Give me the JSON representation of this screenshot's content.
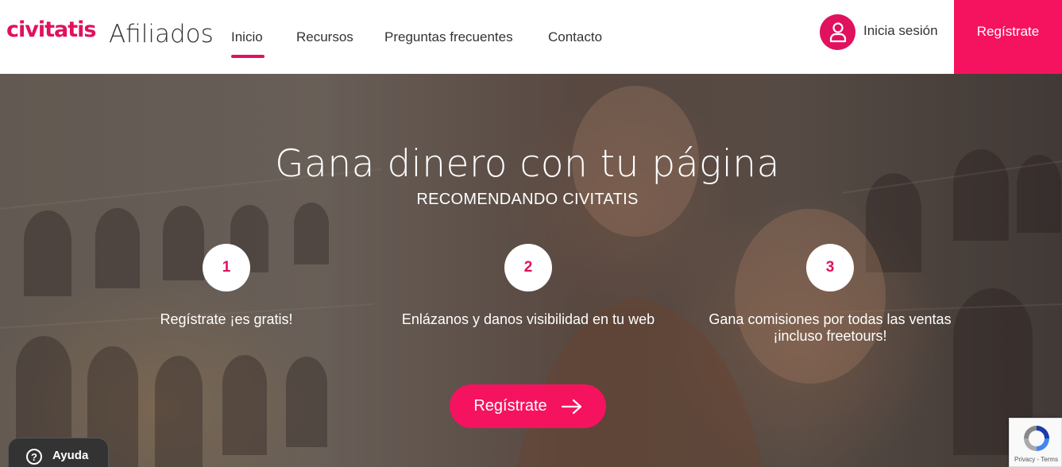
{
  "header": {
    "logo_text": "civitatis",
    "brand_subtitle": "Afiliados",
    "nav": [
      {
        "label": "Inicio",
        "active": true
      },
      {
        "label": "Recursos"
      },
      {
        "label": "Preguntas frecuentes"
      },
      {
        "label": "Contacto"
      }
    ],
    "login_label": "Inicia sesión",
    "register_label": "Regístrate"
  },
  "hero": {
    "title": "Gana dinero con tu página",
    "subtitle": "RECOMENDANDO CIVITATIS",
    "steps": [
      {
        "number": "1",
        "text": "Regístrate ¡es gratis!"
      },
      {
        "number": "2",
        "text": "Enlázanos y danos visibilidad en tu web"
      },
      {
        "number": "3",
        "text": "Gana comisiones por todas las ventas ¡incluso freetours!"
      }
    ],
    "cta_label": "Regístrate"
  },
  "help": {
    "icon": "?",
    "label": "Ayuda"
  },
  "recaptcha": {
    "text": "Privacy - Terms"
  },
  "colors": {
    "accent": "#e0115f",
    "accent_bright": "#f5135f"
  }
}
